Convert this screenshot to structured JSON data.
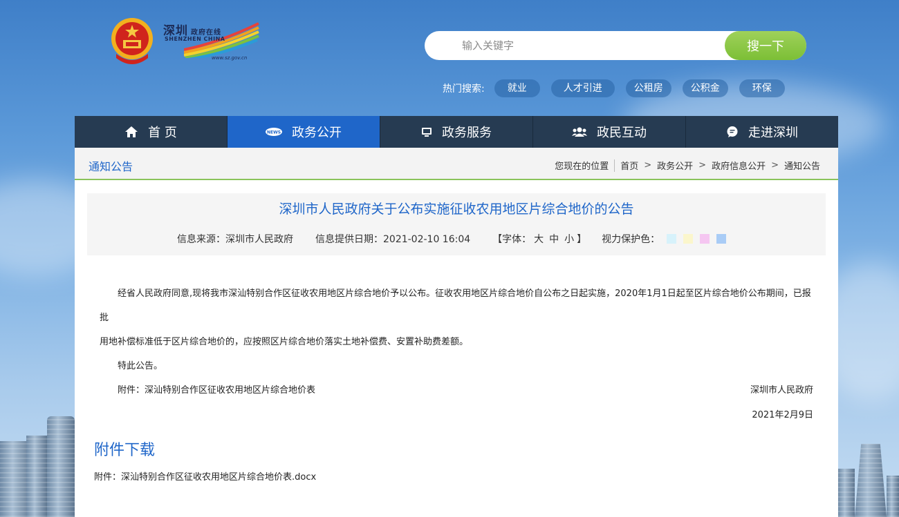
{
  "header": {
    "logo_cn": "深圳",
    "logo_cn_small": "政府在线",
    "logo_en": "SHENZHEN CHINA",
    "logo_url": "www.sz.gov.cn"
  },
  "search": {
    "placeholder": "输入关键字",
    "button_label": "搜一下"
  },
  "hot_search": {
    "label": "热门搜索:",
    "tags": [
      "就业",
      "人才引进",
      "公租房",
      "公积金",
      "环保"
    ]
  },
  "nav": {
    "items": [
      {
        "label": "首 页",
        "icon": "home-icon"
      },
      {
        "label": "政务公开",
        "icon": "news-icon"
      },
      {
        "label": "政务服务",
        "icon": "monitor-icon"
      },
      {
        "label": "政民互动",
        "icon": "users-icon"
      },
      {
        "label": "走进深圳",
        "icon": "chat-icon"
      }
    ],
    "active_index": 1
  },
  "crumbbar": {
    "title": "通知公告",
    "location_label": "您现在的位置",
    "crumbs": [
      "首页",
      "政务公开",
      "政府信息公开",
      "通知公告"
    ]
  },
  "article": {
    "title": "深圳市人民政府关于公布实施征收农用地区片综合地价的公告",
    "source": "信息来源：深圳市人民政府",
    "date": "信息提供日期：2021-02-10 16:04",
    "font_label": "【字体：",
    "font_sizes": [
      "大",
      "中",
      "小"
    ],
    "font_close": "】",
    "eye_label": "视力保护色：",
    "eye_colors": [
      "#d7f2fb",
      "#fbf6cc",
      "#f5c6f1",
      "#a9ccf6"
    ],
    "para1_line1": "经省人民政府同意,现将我市深汕特别合作区征收农用地区片综合地价予以公布。征收农用地区片综合地价自公布之日起实施，2020年1月1日起至区片综合地价公布期间，已报批",
    "para1_line2": "用地补偿标准低于区片综合地价的，应按照区片综合地价落实土地补偿费、安置补助费差额。",
    "para2": "特此公告。",
    "para3": "附件：深汕特别合作区征收农用地区片综合地价表",
    "sign_org": "深圳市人民政府",
    "sign_date": "2021年2月9日"
  },
  "download": {
    "title": "附件下载",
    "prefix": "附件：",
    "file": "深汕特别合作区征收农用地区片综合地价表.docx"
  },
  "colors": {
    "nav_bg": "#263b52",
    "nav_active": "#1f66c9",
    "accent_green": "#8ac35a",
    "search_button": "#7cbf36",
    "title_blue": "#1f66c9"
  }
}
